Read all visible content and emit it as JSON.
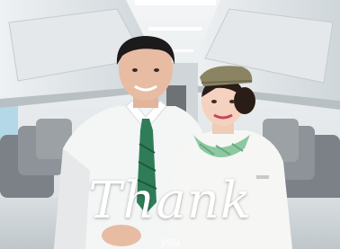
{
  "image": {
    "caption": "Thank",
    "caption_sub": "you"
  },
  "colors": {
    "cabin": "#dfe4e7",
    "uniform_olive": "#8a8462",
    "scarf_green": "#8cc9a0",
    "tie_green": "#2f7d58"
  }
}
